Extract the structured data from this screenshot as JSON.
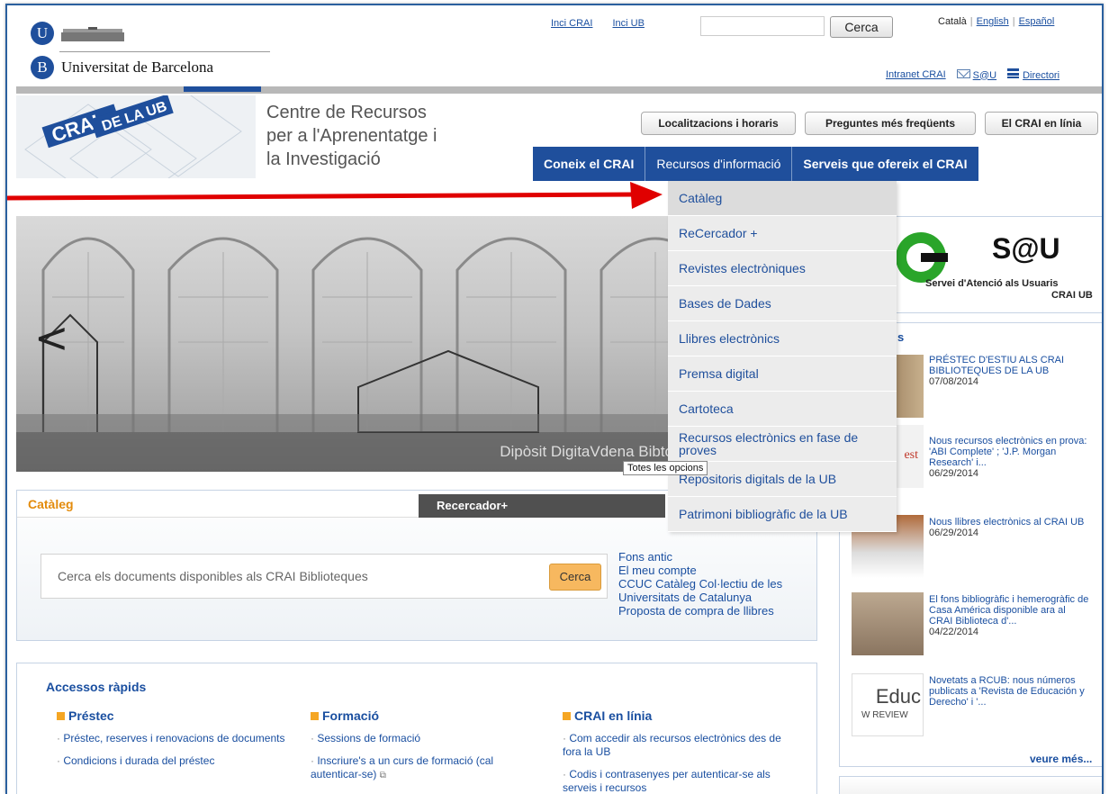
{
  "top": {
    "university": "Universitat de Barcelona",
    "logo_u": "U",
    "logo_b": "B",
    "links": [
      "Inci CRAI",
      "Inci UB"
    ],
    "search_button": "Cerca",
    "lang_active": "Català",
    "lang_links": [
      "English",
      "Español"
    ],
    "intranet": "Intranet CRAI",
    "sau": "S@U",
    "directori": "Directori"
  },
  "header": {
    "title_lines": [
      "Centre de Recursos",
      "per a l'Aprenentatge i",
      "la Investigació"
    ],
    "buttons": [
      "Localitzacions i horaris",
      "Preguntes més freqüents",
      "El CRAI en línia"
    ],
    "nav": [
      "Coneix el CRAI",
      "Recursos d'informació",
      "Serveis que ofereix el CRAI"
    ]
  },
  "dropdown": {
    "items": [
      "Catàleg",
      "ReCercador +",
      "Revistes electròniques",
      "Bases de Dades",
      "Llibres electrònics",
      "Premsa digital",
      "Cartoteca",
      "Recursos electrònics en fase de proves",
      "Repositoris digitals de la UB",
      "Patrimoni bibliogràfic de la UB"
    ],
    "tooltip": "Totes les opcions"
  },
  "slider": {
    "caption": "Dipòsit DigitaVdena Bibto",
    "prev_icon": "chevron-left-icon"
  },
  "catalog": {
    "tab_active": "Catàleg",
    "tab_other": "Recercador+",
    "placeholder": "Cerca els documents disponibles als CRAI Biblioteques",
    "button": "Cerca",
    "links": [
      "Fons antic",
      "El meu compte",
      "CCUC Catàleg Col·lectiu de les",
      "Universitats de Catalunya",
      "Proposta de compra de llibres"
    ]
  },
  "sau_box": {
    "title": "S@U",
    "sub1": "Servei d'Atenció als Usuaris",
    "sub2": "CRAI UB"
  },
  "news": {
    "header_fragment": "s",
    "items": [
      {
        "text": "PRÉSTEC D'ESTIU ALS CRAI BIBLIOTEQUES DE LA UB",
        "date": "07/08/2014"
      },
      {
        "text": "Nous recursos electrònics en prova: 'ABI Complete' ; 'J.P. Morgan Research' i...",
        "date": "06/29/2014"
      },
      {
        "text": "Nous llibres electrònics al CRAI UB",
        "date": "06/29/2014"
      },
      {
        "text": "El fons bibliogràfic i hemerogràfic de Casa América disponible ara al CRAI Biblioteca d'...",
        "date": "04/22/2014"
      },
      {
        "text": "Novetats a RCUB: nous números publicats a 'Revista de Educación y Derecho' i '...",
        "date": ""
      }
    ],
    "thumb_texts": [
      "est",
      "Educ",
      "W REVIEW"
    ],
    "more": "veure més..."
  },
  "quick": {
    "title": "Accessos ràpids",
    "columns": [
      {
        "head": "Préstec",
        "items": [
          "Préstec, reserves i renovacions de documents",
          "Condicions i durada del préstec"
        ]
      },
      {
        "head": "Formació",
        "items": [
          "Sessions de formació",
          "Inscriure's a un curs de formació (cal autenticar-se)"
        ]
      },
      {
        "head": "CRAI en línia",
        "items": [
          "Com accedir als recursos electrònics des de fora la UB",
          "Codis i contrasenyes per autenticar-se als serveis i recursos"
        ]
      }
    ]
  },
  "colors": {
    "blue": "#1f4f9c",
    "orange": "#e38b0c",
    "arrow": "#e00000"
  }
}
